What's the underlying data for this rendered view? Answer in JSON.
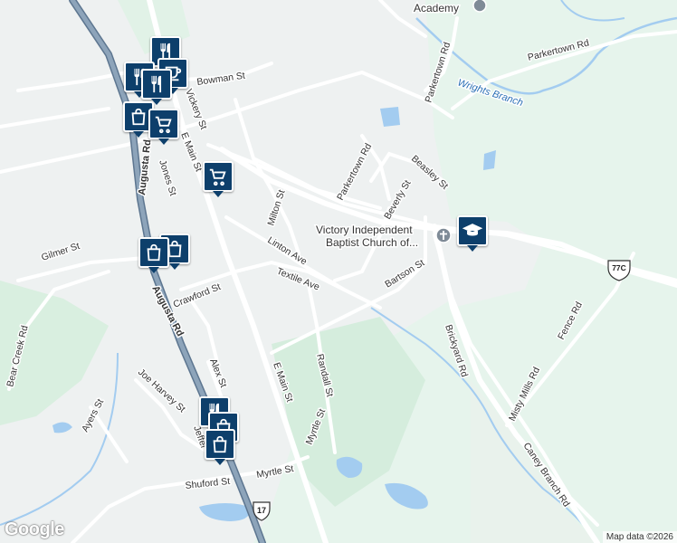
{
  "map": {
    "streets": {
      "bowman": "Bowman St",
      "vickery": "Vickery St",
      "e_main_north": "E Main St",
      "augusta_north": "Augusta Rd",
      "jones": "Jones St",
      "milton": "Milton St",
      "linton": "Linton Ave",
      "parkertown_rd_north": "Parkertown Rd",
      "parkertown_rd_east": "Parkertown Rd",
      "parkertown_rd_mid": "Parkertown Rd",
      "beasley": "Beasley St",
      "beverly": "Beverly St",
      "bartson": "Bartson St",
      "textile": "Textile Ave",
      "crawford": "Crawford St",
      "gilmer": "Gilmer St",
      "augusta_south": "Augusta Rd",
      "bear_creek": "Bear Creek Rd",
      "alex": "Alex St",
      "e_main_south": "E Main St",
      "randall": "Randall St",
      "brickyard": "Brickyard Rd",
      "fence": "Fence Rd",
      "misty_mills": "Misty Mills Rd",
      "joe_harvey": "Joe Harvey St",
      "ayers": "Ayers St",
      "myrtle_ne": "Myrtle St",
      "myrtle_sw": "Myrtle St",
      "shuford": "Shuford St",
      "jeffer": "Jeffer",
      "caney_branch": "Caney Branch Rd"
    },
    "water": {
      "wrights_branch": "Wrights Branch"
    },
    "shields": {
      "route_77c": "77C",
      "route_17": "17"
    },
    "pois": {
      "academy": "Academy",
      "church": "Victory Independent Baptist Church of..."
    },
    "branding": {
      "logo": "Google",
      "attribution": "Map data ©2026"
    },
    "colors": {
      "background_green": "#e8f5ee",
      "urban": "#f1f3f4",
      "road": "#ffffff",
      "highway": "#7d93a8",
      "water": "#a3ccf0",
      "marker": "#0d3f6b"
    },
    "markers": [
      "restaurant-icon",
      "restaurant-icon",
      "cafe-icon",
      "restaurant-icon",
      "shopping-bag-icon",
      "shopping-cart-icon",
      "shopping-cart-icon",
      "shopping-bag-icon",
      "shopping-bag-icon",
      "graduation-cap-icon",
      "restaurant-icon",
      "shopping-bag-icon",
      "shopping-bag-icon"
    ]
  }
}
